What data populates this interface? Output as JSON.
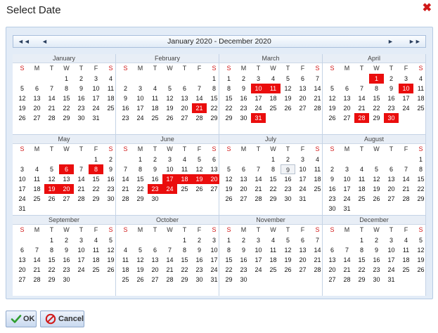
{
  "dialog": {
    "title": "Select Date"
  },
  "nav": {
    "range_label": "January 2020 - December 2020",
    "first": "◄◄",
    "prev": "◄",
    "next": "►",
    "last": "►►"
  },
  "weekdays": [
    "S",
    "M",
    "T",
    "W",
    "T",
    "F",
    "S"
  ],
  "months": [
    {
      "name": "January",
      "start": 3,
      "days": 31,
      "selected": []
    },
    {
      "name": "February",
      "start": 6,
      "days": 29,
      "selected": [
        21
      ]
    },
    {
      "name": "March",
      "start": 0,
      "days": 31,
      "selected": [
        10,
        11,
        31
      ]
    },
    {
      "name": "April",
      "start": 3,
      "days": 30,
      "selected": [
        1,
        10,
        28,
        30
      ]
    },
    {
      "name": "May",
      "start": 5,
      "days": 31,
      "selected": [
        6,
        8,
        19,
        20
      ]
    },
    {
      "name": "June",
      "start": 1,
      "days": 30,
      "selected": [
        17,
        18,
        19,
        20,
        23,
        24
      ]
    },
    {
      "name": "July",
      "start": 3,
      "days": 31,
      "selected": [],
      "today": 9
    },
    {
      "name": "August",
      "start": 6,
      "days": 31,
      "selected": []
    },
    {
      "name": "September",
      "start": 2,
      "days": 30,
      "selected": []
    },
    {
      "name": "October",
      "start": 4,
      "days": 31,
      "selected": []
    },
    {
      "name": "November",
      "start": 0,
      "days": 30,
      "selected": []
    },
    {
      "name": "December",
      "start": 2,
      "days": 31,
      "selected": []
    }
  ],
  "buttons": {
    "ok": "OK",
    "cancel": "Cancel"
  },
  "colors": {
    "selected": "#ea0d0d",
    "weekend_header": "#d01818",
    "ok_icon": "#2e9e2e",
    "cancel_icon": "#d01818"
  }
}
